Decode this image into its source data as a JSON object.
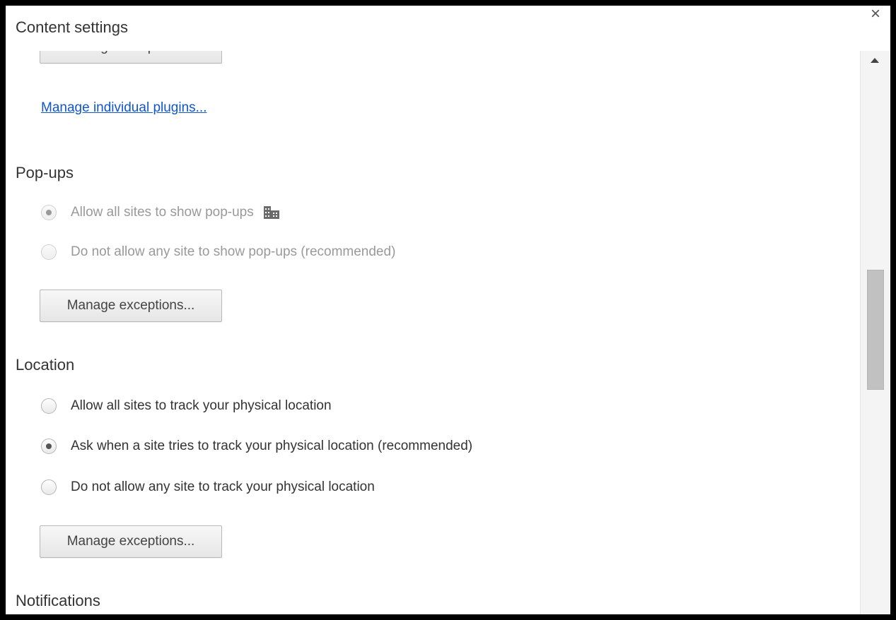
{
  "dialog": {
    "title": "Content settings",
    "close_glyph": "×"
  },
  "plugins": {
    "partial_button_label": "Manage exceptions...",
    "link_label": "Manage individual plugins..."
  },
  "popups": {
    "heading": "Pop-ups",
    "options": [
      {
        "label": "Allow all sites to show pop-ups",
        "selected": true,
        "disabled": true,
        "policy_icon": "managed-by-policy-icon"
      },
      {
        "label": "Do not allow any site to show pop-ups (recommended)",
        "selected": false,
        "disabled": true
      }
    ],
    "button_label": "Manage exceptions..."
  },
  "location": {
    "heading": "Location",
    "options": [
      {
        "label": "Allow all sites to track your physical location",
        "selected": false
      },
      {
        "label": "Ask when a site tries to track your physical location (recommended)",
        "selected": true
      },
      {
        "label": "Do not allow any site to track your physical location",
        "selected": false
      }
    ],
    "button_label": "Manage exceptions..."
  },
  "notifications": {
    "heading": "Notifications"
  },
  "colors": {
    "link": "#1155cc",
    "disabled_text": "#999999",
    "text": "#333333"
  }
}
